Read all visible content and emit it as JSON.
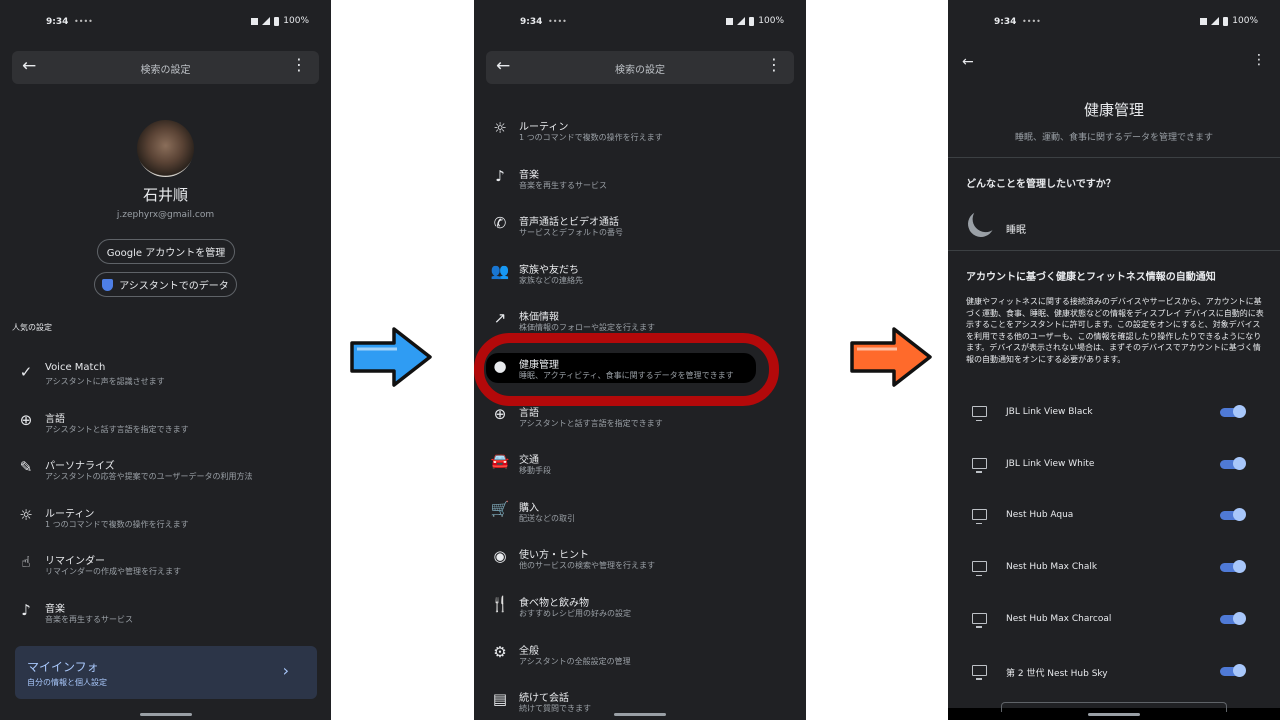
{
  "status": {
    "time": "9:34",
    "battery": "100%",
    "small": "••••"
  },
  "panel1": {
    "title": "検索の設定",
    "profile": {
      "name": "石井順",
      "email": "j.zephyrx@gmail.com"
    },
    "manage_account": "Google アカウントを管理",
    "assistant_data": "アシスタントでのデータ",
    "section_label": "人気の設定",
    "items": [
      {
        "icon": "voice-match-icon",
        "glyph": "✓",
        "title": "Voice Match",
        "subtitle": "アシスタントに声を認識させます"
      },
      {
        "icon": "globe-icon",
        "glyph": "⊕",
        "title": "言語",
        "subtitle": "アシスタントと話す言語を指定できます"
      },
      {
        "icon": "personalize-icon",
        "glyph": "✎",
        "title": "パーソナライズ",
        "subtitle": "アシスタントの応答や提案でのユーザーデータの利用方法"
      },
      {
        "icon": "routine-icon",
        "glyph": "☼",
        "title": "ルーティン",
        "subtitle": "1 つのコマンドで複数の操作を行えます"
      },
      {
        "icon": "reminder-icon",
        "glyph": "☝",
        "title": "リマインダー",
        "subtitle": "リマインダーの作成や管理を行えます"
      },
      {
        "icon": "music-note-icon",
        "glyph": "♪",
        "title": "音楽",
        "subtitle": "音楽を再生するサービス"
      }
    ],
    "info_card": {
      "title": "マイインフォ",
      "subtitle": "自分の情報と個人設定"
    }
  },
  "panel2": {
    "title": "検索の設定",
    "items": [
      {
        "icon": "routine-icon",
        "glyph": "☼",
        "title": "ルーティン",
        "subtitle": "1 つのコマンドで複数の操作を行えます"
      },
      {
        "icon": "music-note-icon",
        "glyph": "♪",
        "title": "音楽",
        "subtitle": "音楽を再生するサービス"
      },
      {
        "icon": "phone-icon",
        "glyph": "✆",
        "title": "音声通話とビデオ通話",
        "subtitle": "サービスとデフォルトの番号"
      },
      {
        "icon": "people-icon",
        "glyph": "👥",
        "title": "家族や友だち",
        "subtitle": "家族などの連絡先"
      },
      {
        "icon": "trending-up-icon",
        "glyph": "↗",
        "title": "株価情報",
        "subtitle": "株価情報のフォローや設定を行えます"
      },
      {
        "icon": "person-icon",
        "glyph": "●",
        "title": "健康管理",
        "subtitle": "睡眠、アクティビティ、食事に関するデータを管理できます"
      },
      {
        "icon": "globe-icon",
        "glyph": "⊕",
        "title": "言語",
        "subtitle": "アシスタントと話す言語を指定できます"
      },
      {
        "icon": "car-icon",
        "glyph": "🚘",
        "title": "交通",
        "subtitle": "移動手段"
      },
      {
        "icon": "cart-icon",
        "glyph": "🛒",
        "title": "購入",
        "subtitle": "配送などの取引"
      },
      {
        "icon": "compass-icon",
        "glyph": "◉",
        "title": "使い方・ヒント",
        "subtitle": "他のサービスの検索や管理を行えます"
      },
      {
        "icon": "fork-knife-icon",
        "glyph": "🍴",
        "title": "食べ物と飲み物",
        "subtitle": "おすすめレシピ用の好みの設定"
      },
      {
        "icon": "gear-icon",
        "glyph": "⚙",
        "title": "全般",
        "subtitle": "アシスタントの全般設定の管理"
      },
      {
        "icon": "chat-icon",
        "glyph": "▤",
        "title": "続けて会話",
        "subtitle": "続けて質問できます"
      }
    ]
  },
  "panel3": {
    "title": "健康管理",
    "subtitle": "睡眠、運動、食事に関するデータを管理できます",
    "question": "どんなことを管理したいですか？",
    "sleep": "睡眠",
    "notify_heading": "アカウントに基づく健康とフィットネス情報の自動通知",
    "notify_body": "健康やフィットネスに関する接続済みのデバイスやサービスから、アカウントに基づく運動、食事、睡眠、健康状態などの情報をディスプレイ デバイスに自動的に表示することをアシスタントに許可します。この設定をオンにすると、対象デバイスを利用できる他のユーザーも、この情報を確認したり操作したりできるようになります。デバイスが表示されない場合は、まずそのデバイスでアカウントに基づく情報の自動通知をオンにする必要があります。",
    "devices": [
      {
        "name": "JBL Link View Black",
        "on": true
      },
      {
        "name": "JBL Link View White",
        "on": true
      },
      {
        "name": "Nest Hub Aqua",
        "on": true
      },
      {
        "name": "Nest Hub Max Chalk",
        "on": true
      },
      {
        "name": "Nest Hub Max Charcoal",
        "on": true
      },
      {
        "name": "第 2 世代 Nest Hub Sky",
        "on": true
      }
    ]
  },
  "colors": {
    "arrow1": "#2f9cf3",
    "arrow2": "#ff6a2b",
    "highlight": "#b3090a",
    "toggle": "#4f7ad6"
  }
}
